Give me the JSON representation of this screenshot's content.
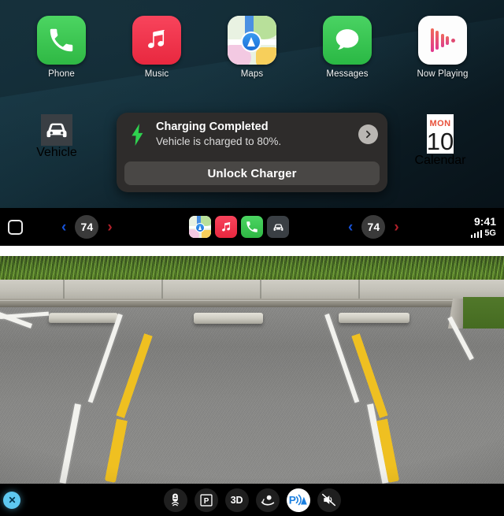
{
  "carplay": {
    "apps": [
      {
        "label": "Phone",
        "icon": "phone-icon"
      },
      {
        "label": "Music",
        "icon": "music-note-icon"
      },
      {
        "label": "Maps",
        "icon": "maps-icon"
      },
      {
        "label": "Messages",
        "icon": "messages-bubble-icon"
      },
      {
        "label": "Now Playing",
        "icon": "now-playing-icon"
      }
    ],
    "vehicle": {
      "label": "Vehicle",
      "icon": "car-front-icon"
    },
    "calendar": {
      "label": "Calendar",
      "weekday": "MON",
      "day": "10",
      "icon": "calendar-icon"
    },
    "notification": {
      "icon": "charging-bolt-icon",
      "title": "Charging Completed",
      "subtitle": "Vehicle is charged to 80%.",
      "chevron_icon": "chevron-right-icon",
      "action_label": "Unlock Charger"
    },
    "status_bar": {
      "home_icon": "home-square-icon",
      "left_climate": {
        "prev_icon": "chevron-left-icon",
        "temperature": "74",
        "next_icon": "chevron-right-icon"
      },
      "right_climate": {
        "prev_icon": "chevron-left-icon",
        "temperature": "74",
        "next_icon": "chevron-right-icon"
      },
      "dock_apps": [
        {
          "name": "maps-dock-icon"
        },
        {
          "name": "music-dock-icon"
        },
        {
          "name": "phone-dock-icon"
        },
        {
          "name": "vehicle-dock-icon"
        }
      ],
      "clock": "9:41",
      "signal_icon": "cellular-bars-icon",
      "network": "5G"
    },
    "colors": {
      "phone_green": "#3cc74f",
      "music_red": "#ef3049",
      "messages_green": "#35c44e",
      "calendar_red": "#e8503a",
      "charging_green": "#2fd14f",
      "climate_left_blue": "#1752d8",
      "climate_right_red": "#b0202a",
      "background_dark": "#0c1c24"
    }
  },
  "camera": {
    "view_name": "rear-parking-camera",
    "close_icon": "close-x-icon",
    "toolbar": [
      {
        "name": "parking-sensor-car-icon",
        "label": "",
        "active": false
      },
      {
        "name": "park-assist-p-icon",
        "label": "",
        "active": false
      },
      {
        "name": "three-d-view-button",
        "label": "3D",
        "active": false
      },
      {
        "name": "camera-wash-icon",
        "label": "",
        "active": false
      },
      {
        "name": "park-distance-alert-icon",
        "label": "",
        "active": true
      },
      {
        "name": "mute-speaker-icon",
        "label": "",
        "active": false
      }
    ],
    "overlay": {
      "guide_color": "#efc021",
      "stall_line_color": "#f2f2ee"
    }
  }
}
